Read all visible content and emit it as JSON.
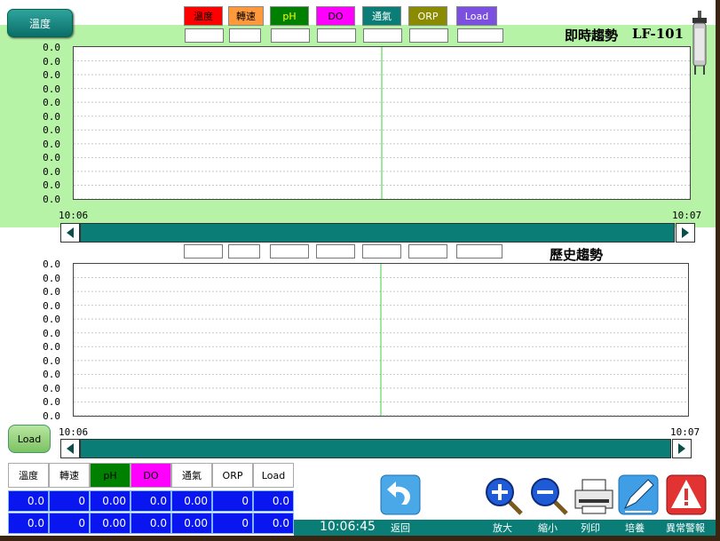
{
  "top_button": "溫度",
  "legend": [
    {
      "label": "溫度",
      "color": "#ff0000",
      "text_color": "#000000"
    },
    {
      "label": "轉速",
      "color": "#ff9a3c",
      "text_color": "#000000"
    },
    {
      "label": "pH",
      "color": "#008000",
      "text_color": "#ffff00"
    },
    {
      "label": "DO",
      "color": "#ff00ff",
      "text_color": "#000000"
    },
    {
      "label": "通氣",
      "color": "#0b7d77",
      "text_color": "#ffffff"
    },
    {
      "label": "ORP",
      "color": "#8b8b00",
      "text_color": "#ffffff"
    },
    {
      "label": "Load",
      "color": "#7b4fe0",
      "text_color": "#ffffff"
    }
  ],
  "realtime": {
    "title": "即時趨勢",
    "unit": "LF-101",
    "y_labels": [
      "0.0",
      "0.0",
      "0.0",
      "0.0",
      "0.0",
      "0.0",
      "0.0",
      "0.0",
      "0.0",
      "0.0",
      "0.0",
      "0.0"
    ],
    "t_start": "10:06",
    "t_end": "10:07"
  },
  "history": {
    "title": "歷史趨勢",
    "y_labels": [
      "0.0",
      "0.0",
      "0.0",
      "0.0",
      "0.0",
      "0.0",
      "0.0",
      "0.0",
      "0.0",
      "0.0",
      "0.0",
      "0.0"
    ],
    "t_start": "10:06",
    "t_end": "10:07"
  },
  "load_button": "Load",
  "table": {
    "headers": [
      {
        "label": "溫度",
        "bg": "#ffffff"
      },
      {
        "label": "轉速",
        "bg": "#ffffff"
      },
      {
        "label": "pH",
        "bg": "#008000"
      },
      {
        "label": "DO",
        "bg": "#ff00ff"
      },
      {
        "label": "通氣",
        "bg": "#ffffff"
      },
      {
        "label": "ORP",
        "bg": "#ffffff"
      },
      {
        "label": "Load",
        "bg": "#ffffff"
      }
    ],
    "row1": [
      "0.0",
      "0",
      "0.00",
      "0.0",
      "0.00",
      "0",
      "0.0"
    ],
    "row2": [
      "0.0",
      "0",
      "0.00",
      "0.0",
      "0.00",
      "0",
      "0.0"
    ]
  },
  "clock": "10:06:45",
  "toolbar": {
    "back": "返回",
    "zoom_in": "放大",
    "zoom_out": "縮小",
    "print": "列印",
    "culture": "培養",
    "alarm": "異常警報"
  }
}
